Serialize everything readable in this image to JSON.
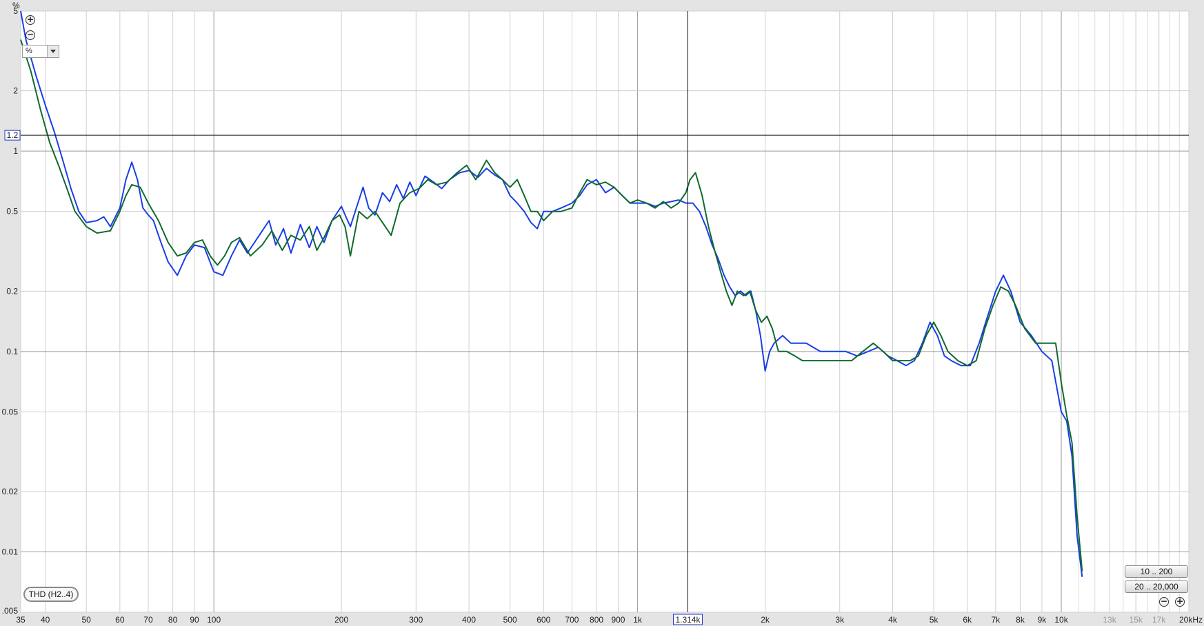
{
  "y_unit_label": "%",
  "unit_selector": {
    "value": "%"
  },
  "legend": {
    "label": "THD (H2..4)"
  },
  "range_buttons": [
    "10 .. 200",
    "20 .. 20,000"
  ],
  "colors": {
    "blue_trace": "#1a3ee8",
    "green_trace": "#0f6a2c",
    "background": "#ffffff",
    "grid": "#c8c8c8"
  },
  "icons": {
    "zoom_in": "zoom-in-icon",
    "zoom_out": "zoom-out-icon",
    "dropdown": "chevron-down-icon"
  },
  "chart_data": {
    "type": "line",
    "xscale": "log",
    "yscale": "log",
    "xlim": [
      35,
      20000
    ],
    "ylim": [
      0.005,
      5
    ],
    "grid": true,
    "y_ticks": [
      {
        "value": 5,
        "label": "5"
      },
      {
        "value": 2,
        "label": "2"
      },
      {
        "value": 1,
        "label": "1"
      },
      {
        "value": 0.5,
        "label": "0.5"
      },
      {
        "value": 0.2,
        "label": "0.2"
      },
      {
        "value": 0.1,
        "label": "0.1"
      },
      {
        "value": 0.05,
        "label": "0.05"
      },
      {
        "value": 0.02,
        "label": "0.02"
      },
      {
        "value": 0.01,
        "label": "0.01"
      },
      {
        "value": 0.005,
        "label": ".005"
      }
    ],
    "x_ticks": [
      {
        "value": 35,
        "label": "35"
      },
      {
        "value": 40,
        "label": "40"
      },
      {
        "value": 50,
        "label": "50"
      },
      {
        "value": 60,
        "label": "60"
      },
      {
        "value": 70,
        "label": "70"
      },
      {
        "value": 80,
        "label": "80"
      },
      {
        "value": 90,
        "label": "90"
      },
      {
        "value": 100,
        "label": "100"
      },
      {
        "value": 200,
        "label": "200"
      },
      {
        "value": 300,
        "label": "300"
      },
      {
        "value": 400,
        "label": "400"
      },
      {
        "value": 500,
        "label": "500"
      },
      {
        "value": 600,
        "label": "600"
      },
      {
        "value": 700,
        "label": "700"
      },
      {
        "value": 800,
        "label": "800"
      },
      {
        "value": 900,
        "label": "900"
      },
      {
        "value": 1000,
        "label": "1k"
      },
      {
        "value": 2000,
        "label": "2k"
      },
      {
        "value": 3000,
        "label": "3k"
      },
      {
        "value": 4000,
        "label": "4k"
      },
      {
        "value": 5000,
        "label": "5k"
      },
      {
        "value": 6000,
        "label": "6k"
      },
      {
        "value": 7000,
        "label": "7k"
      },
      {
        "value": 8000,
        "label": "8k"
      },
      {
        "value": 9000,
        "label": "9k"
      },
      {
        "value": 10000,
        "label": "10k"
      },
      {
        "value": 13000,
        "label": "13k",
        "faded": true
      },
      {
        "value": 15000,
        "label": "15k",
        "faded": true
      },
      {
        "value": 17000,
        "label": "17k",
        "faded": true
      },
      {
        "value": 20000,
        "label": "20kHz"
      }
    ],
    "cursor": {
      "x": 1314,
      "x_label": "1.314k",
      "y": 1.2,
      "y_label": "1.2"
    },
    "series": [
      {
        "color": "#1a3ee8",
        "points": [
          [
            35,
            5
          ],
          [
            36,
            3.6
          ],
          [
            38,
            2.4
          ],
          [
            40,
            1.7
          ],
          [
            42,
            1.25
          ],
          [
            44,
            0.9
          ],
          [
            46,
            0.65
          ],
          [
            48,
            0.5
          ],
          [
            50,
            0.44
          ],
          [
            53,
            0.45
          ],
          [
            55,
            0.47
          ],
          [
            57,
            0.42
          ],
          [
            60,
            0.52
          ],
          [
            62,
            0.72
          ],
          [
            64,
            0.88
          ],
          [
            66,
            0.72
          ],
          [
            68,
            0.52
          ],
          [
            70,
            0.48
          ],
          [
            72,
            0.45
          ],
          [
            75,
            0.35
          ],
          [
            78,
            0.28
          ],
          [
            82,
            0.24
          ],
          [
            86,
            0.3
          ],
          [
            90,
            0.34
          ],
          [
            95,
            0.33
          ],
          [
            100,
            0.25
          ],
          [
            105,
            0.24
          ],
          [
            110,
            0.3
          ],
          [
            115,
            0.36
          ],
          [
            120,
            0.31
          ],
          [
            128,
            0.38
          ],
          [
            135,
            0.45
          ],
          [
            140,
            0.34
          ],
          [
            146,
            0.41
          ],
          [
            152,
            0.31
          ],
          [
            160,
            0.43
          ],
          [
            168,
            0.33
          ],
          [
            175,
            0.42
          ],
          [
            182,
            0.35
          ],
          [
            190,
            0.45
          ],
          [
            200,
            0.53
          ],
          [
            205,
            0.47
          ],
          [
            210,
            0.42
          ],
          [
            220,
            0.57
          ],
          [
            225,
            0.66
          ],
          [
            232,
            0.52
          ],
          [
            240,
            0.48
          ],
          [
            250,
            0.62
          ],
          [
            260,
            0.56
          ],
          [
            270,
            0.68
          ],
          [
            280,
            0.58
          ],
          [
            290,
            0.7
          ],
          [
            300,
            0.6
          ],
          [
            315,
            0.75
          ],
          [
            330,
            0.7
          ],
          [
            345,
            0.65
          ],
          [
            360,
            0.72
          ],
          [
            380,
            0.78
          ],
          [
            400,
            0.8
          ],
          [
            420,
            0.74
          ],
          [
            440,
            0.82
          ],
          [
            460,
            0.76
          ],
          [
            480,
            0.72
          ],
          [
            500,
            0.6
          ],
          [
            520,
            0.55
          ],
          [
            540,
            0.5
          ],
          [
            560,
            0.44
          ],
          [
            580,
            0.41
          ],
          [
            600,
            0.5
          ],
          [
            630,
            0.5
          ],
          [
            660,
            0.52
          ],
          [
            700,
            0.55
          ],
          [
            730,
            0.6
          ],
          [
            760,
            0.68
          ],
          [
            800,
            0.72
          ],
          [
            840,
            0.62
          ],
          [
            880,
            0.66
          ],
          [
            920,
            0.6
          ],
          [
            960,
            0.55
          ],
          [
            1000,
            0.55
          ],
          [
            1050,
            0.55
          ],
          [
            1100,
            0.53
          ],
          [
            1150,
            0.55
          ],
          [
            1200,
            0.56
          ],
          [
            1250,
            0.57
          ],
          [
            1300,
            0.55
          ],
          [
            1350,
            0.55
          ],
          [
            1400,
            0.5
          ],
          [
            1450,
            0.42
          ],
          [
            1500,
            0.34
          ],
          [
            1550,
            0.29
          ],
          [
            1600,
            0.24
          ],
          [
            1650,
            0.21
          ],
          [
            1700,
            0.19
          ],
          [
            1750,
            0.2
          ],
          [
            1800,
            0.19
          ],
          [
            1850,
            0.2
          ],
          [
            1900,
            0.16
          ],
          [
            1950,
            0.12
          ],
          [
            2000,
            0.08
          ],
          [
            2050,
            0.1
          ],
          [
            2100,
            0.11
          ],
          [
            2200,
            0.12
          ],
          [
            2300,
            0.11
          ],
          [
            2400,
            0.11
          ],
          [
            2500,
            0.11
          ],
          [
            2700,
            0.1
          ],
          [
            2900,
            0.1
          ],
          [
            3100,
            0.1
          ],
          [
            3300,
            0.095
          ],
          [
            3500,
            0.1
          ],
          [
            3700,
            0.105
          ],
          [
            3900,
            0.095
          ],
          [
            4100,
            0.09
          ],
          [
            4300,
            0.085
          ],
          [
            4500,
            0.09
          ],
          [
            4700,
            0.11
          ],
          [
            4900,
            0.14
          ],
          [
            5100,
            0.12
          ],
          [
            5300,
            0.095
          ],
          [
            5500,
            0.09
          ],
          [
            5800,
            0.085
          ],
          [
            6100,
            0.085
          ],
          [
            6400,
            0.11
          ],
          [
            6700,
            0.15
          ],
          [
            7000,
            0.2
          ],
          [
            7300,
            0.24
          ],
          [
            7600,
            0.2
          ],
          [
            8000,
            0.14
          ],
          [
            8500,
            0.12
          ],
          [
            9000,
            0.1
          ],
          [
            9500,
            0.09
          ],
          [
            10000,
            0.05
          ],
          [
            10300,
            0.045
          ],
          [
            10600,
            0.03
          ],
          [
            10900,
            0.012
          ],
          [
            11200,
            0.0075
          ]
        ]
      },
      {
        "color": "#0f6a2c",
        "points": [
          [
            35,
            3.6
          ],
          [
            37,
            2.5
          ],
          [
            39,
            1.6
          ],
          [
            41,
            1.1
          ],
          [
            43,
            0.85
          ],
          [
            45,
            0.65
          ],
          [
            47,
            0.5
          ],
          [
            50,
            0.42
          ],
          [
            53,
            0.39
          ],
          [
            57,
            0.4
          ],
          [
            60,
            0.5
          ],
          [
            62,
            0.6
          ],
          [
            64,
            0.68
          ],
          [
            67,
            0.66
          ],
          [
            70,
            0.55
          ],
          [
            74,
            0.45
          ],
          [
            78,
            0.35
          ],
          [
            82,
            0.3
          ],
          [
            86,
            0.31
          ],
          [
            90,
            0.35
          ],
          [
            94,
            0.36
          ],
          [
            98,
            0.3
          ],
          [
            102,
            0.27
          ],
          [
            106,
            0.3
          ],
          [
            110,
            0.35
          ],
          [
            115,
            0.37
          ],
          [
            122,
            0.3
          ],
          [
            130,
            0.34
          ],
          [
            137,
            0.4
          ],
          [
            145,
            0.32
          ],
          [
            152,
            0.38
          ],
          [
            160,
            0.36
          ],
          [
            168,
            0.42
          ],
          [
            175,
            0.32
          ],
          [
            182,
            0.37
          ],
          [
            190,
            0.45
          ],
          [
            198,
            0.48
          ],
          [
            204,
            0.42
          ],
          [
            210,
            0.3
          ],
          [
            220,
            0.5
          ],
          [
            230,
            0.46
          ],
          [
            240,
            0.5
          ],
          [
            250,
            0.44
          ],
          [
            262,
            0.38
          ],
          [
            275,
            0.55
          ],
          [
            290,
            0.62
          ],
          [
            305,
            0.65
          ],
          [
            320,
            0.72
          ],
          [
            335,
            0.68
          ],
          [
            355,
            0.7
          ],
          [
            375,
            0.78
          ],
          [
            395,
            0.85
          ],
          [
            415,
            0.72
          ],
          [
            440,
            0.9
          ],
          [
            460,
            0.78
          ],
          [
            480,
            0.72
          ],
          [
            500,
            0.66
          ],
          [
            520,
            0.72
          ],
          [
            540,
            0.6
          ],
          [
            560,
            0.5
          ],
          [
            580,
            0.5
          ],
          [
            600,
            0.45
          ],
          [
            630,
            0.5
          ],
          [
            660,
            0.5
          ],
          [
            700,
            0.52
          ],
          [
            730,
            0.62
          ],
          [
            760,
            0.72
          ],
          [
            800,
            0.68
          ],
          [
            840,
            0.7
          ],
          [
            880,
            0.66
          ],
          [
            920,
            0.6
          ],
          [
            960,
            0.55
          ],
          [
            1000,
            0.57
          ],
          [
            1050,
            0.55
          ],
          [
            1100,
            0.52
          ],
          [
            1150,
            0.56
          ],
          [
            1200,
            0.52
          ],
          [
            1250,
            0.55
          ],
          [
            1300,
            0.62
          ],
          [
            1330,
            0.72
          ],
          [
            1370,
            0.78
          ],
          [
            1420,
            0.6
          ],
          [
            1470,
            0.42
          ],
          [
            1520,
            0.32
          ],
          [
            1570,
            0.25
          ],
          [
            1620,
            0.2
          ],
          [
            1670,
            0.17
          ],
          [
            1720,
            0.2
          ],
          [
            1780,
            0.19
          ],
          [
            1840,
            0.2
          ],
          [
            1900,
            0.16
          ],
          [
            1960,
            0.14
          ],
          [
            2020,
            0.15
          ],
          [
            2080,
            0.13
          ],
          [
            2150,
            0.1
          ],
          [
            2250,
            0.1
          ],
          [
            2350,
            0.095
          ],
          [
            2450,
            0.09
          ],
          [
            2600,
            0.09
          ],
          [
            2800,
            0.09
          ],
          [
            3000,
            0.09
          ],
          [
            3200,
            0.09
          ],
          [
            3400,
            0.1
          ],
          [
            3600,
            0.11
          ],
          [
            3800,
            0.1
          ],
          [
            4000,
            0.09
          ],
          [
            4200,
            0.09
          ],
          [
            4400,
            0.09
          ],
          [
            4600,
            0.095
          ],
          [
            4800,
            0.12
          ],
          [
            5000,
            0.14
          ],
          [
            5200,
            0.12
          ],
          [
            5400,
            0.1
          ],
          [
            5700,
            0.09
          ],
          [
            6000,
            0.085
          ],
          [
            6300,
            0.09
          ],
          [
            6600,
            0.13
          ],
          [
            6900,
            0.17
          ],
          [
            7200,
            0.21
          ],
          [
            7500,
            0.2
          ],
          [
            7800,
            0.17
          ],
          [
            8200,
            0.13
          ],
          [
            8700,
            0.11
          ],
          [
            9200,
            0.11
          ],
          [
            9700,
            0.11
          ],
          [
            10000,
            0.07
          ],
          [
            10300,
            0.048
          ],
          [
            10600,
            0.035
          ],
          [
            10900,
            0.015
          ],
          [
            11200,
            0.008
          ]
        ]
      }
    ]
  }
}
